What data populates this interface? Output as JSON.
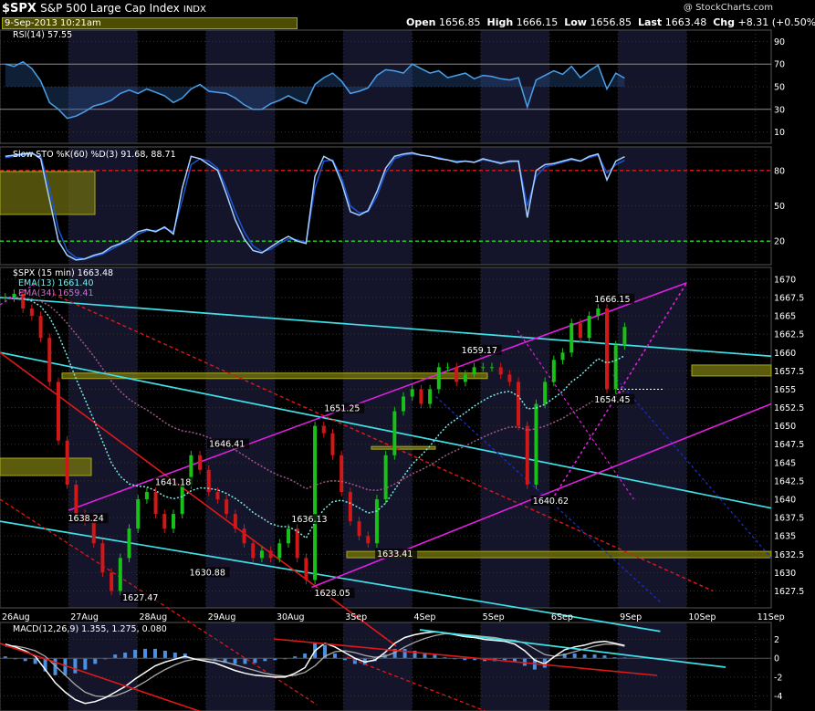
{
  "header": {
    "symbol": "$SPX",
    "name": "S&P 500 Large Cap Index",
    "exchange": "INDX",
    "datetime": "9-Sep-2013 10:21am",
    "copyright": "@ StockCharts.com",
    "open_label": "Open",
    "open": "1656.85",
    "high_label": "High",
    "high": "1666.15",
    "low_label": "Low",
    "low": "1656.85",
    "last_label": "Last",
    "last": "1663.48",
    "chg_label": "Chg",
    "chg": "+8.31 (+0.50%)"
  },
  "colors": {
    "background": "#000000",
    "session_band": "#14142a",
    "cyan": "#40e0e8",
    "magenta": "#e020e0",
    "red": "#e01818",
    "blue": "#1a2cc8",
    "up": "#18c018",
    "down": "#d01818",
    "highlight": "#6b6b10"
  },
  "x_axis": {
    "labels": [
      "26Aug",
      "27Aug",
      "28Aug",
      "29Aug",
      "30Aug",
      "3Sep",
      "4Sep",
      "5Sep",
      "6Sep",
      "9Sep",
      "10Sep",
      "11Sep"
    ],
    "positions": [
      0,
      26,
      52,
      78,
      104,
      130,
      156,
      182,
      208,
      234,
      260,
      286
    ]
  },
  "chart_data": [
    {
      "type": "line",
      "panel": "rsi",
      "title": "RSI(14) 57.55",
      "ylim": [
        0,
        100
      ],
      "yticks": [
        90,
        70,
        50,
        30,
        10
      ],
      "reference_lines": [
        70,
        30
      ],
      "series": [
        {
          "name": "RSI(14)",
          "values": [
            70,
            68,
            72,
            66,
            55,
            36,
            30,
            22,
            24,
            28,
            33,
            35,
            38,
            44,
            47,
            44,
            48,
            45,
            42,
            36,
            40,
            48,
            52,
            46,
            45,
            44,
            40,
            34,
            30,
            30,
            35,
            38,
            42,
            38,
            35,
            52,
            58,
            62,
            55,
            44,
            46,
            49,
            60,
            65,
            64,
            62,
            70,
            66,
            62,
            64,
            58,
            60,
            62,
            57,
            60,
            59,
            57,
            56,
            58,
            32,
            56,
            60,
            64,
            61,
            68,
            58,
            64,
            69,
            48,
            62,
            57.55
          ]
        }
      ]
    },
    {
      "type": "line",
      "panel": "stochastic",
      "title": "Slow STO %K(60) %D(3) 91.68, 88.71",
      "ylim": [
        0,
        100
      ],
      "yticks": [
        80,
        50,
        20
      ],
      "reference_lines": [
        80,
        20
      ],
      "series": [
        {
          "name": "%K",
          "values": [
            92,
            93,
            94,
            95,
            90,
            55,
            20,
            8,
            4,
            5,
            8,
            10,
            15,
            18,
            22,
            28,
            30,
            28,
            32,
            26,
            65,
            92,
            90,
            85,
            80,
            60,
            38,
            22,
            12,
            10,
            15,
            20,
            24,
            20,
            18,
            75,
            92,
            88,
            70,
            45,
            42,
            46,
            62,
            82,
            92,
            94,
            95,
            93,
            92,
            90,
            89,
            87,
            88,
            87,
            90,
            88,
            86,
            88,
            88,
            40,
            80,
            85,
            86,
            88,
            90,
            88,
            92,
            94,
            72,
            88,
            91.68
          ]
        },
        {
          "name": "%D",
          "values": [
            91,
            92,
            93,
            94,
            92,
            65,
            30,
            12,
            6,
            5,
            7,
            9,
            13,
            17,
            20,
            26,
            29,
            29,
            31,
            28,
            55,
            85,
            90,
            88,
            82,
            65,
            45,
            28,
            16,
            11,
            13,
            18,
            22,
            21,
            19,
            65,
            88,
            89,
            74,
            50,
            44,
            45,
            58,
            78,
            90,
            93,
            94,
            93,
            92,
            91,
            89,
            88,
            88,
            87,
            89,
            88,
            87,
            87,
            88,
            50,
            75,
            83,
            85,
            87,
            89,
            88,
            91,
            93,
            78,
            85,
            88.71
          ]
        }
      ]
    },
    {
      "type": "line",
      "panel": "price",
      "title": "$SPX (15 min) 1663.48",
      "legend": [
        "EMA(13) 1661.40",
        "EMA(34) 1659.41"
      ],
      "ylim": [
        1625.2,
        1671.6
      ],
      "yticks": [
        1670,
        1667.5,
        1665,
        1662.5,
        1660,
        1657.5,
        1655,
        1652.5,
        1650,
        1647.5,
        1645,
        1642.5,
        1640,
        1637.5,
        1635,
        1632.5,
        1630,
        1627.5
      ],
      "annotations": [
        {
          "label": "1666.15",
          "x": 232.3,
          "y": 1666.15
        },
        {
          "label": "1659.17",
          "x": 182,
          "y": 1659.17
        },
        {
          "label": "1651.25",
          "x": 130,
          "y": 1651.25
        },
        {
          "label": "1654.45",
          "x": 232.3,
          "y": 1654.45
        },
        {
          "label": "1646.41",
          "x": 86.4,
          "y": 1646.41
        },
        {
          "label": "1641.18",
          "x": 66,
          "y": 1641.18
        },
        {
          "label": "1638.24",
          "x": 33,
          "y": 1638.24
        },
        {
          "label": "1636.13",
          "x": 117.6,
          "y": 1636.13
        },
        {
          "label": "1640.62",
          "x": 209,
          "y": 1640.62
        },
        {
          "label": "1633.41",
          "x": 150,
          "y": 1633.41
        },
        {
          "label": "1630.88",
          "x": 79,
          "y": 1630.88
        },
        {
          "label": "1627.47",
          "x": 53.6,
          "y": 1627.47
        },
        {
          "label": "1628.05",
          "x": 126.3,
          "y": 1628.05
        }
      ],
      "series": [
        {
          "name": "$SPX",
          "values": [
            1667.5,
            1668,
            1666,
            1665,
            1662,
            1656,
            1648,
            1642,
            1638,
            1637,
            1634,
            1630,
            1627.5,
            1632,
            1636,
            1640,
            1641,
            1638,
            1636,
            1638,
            1642,
            1646,
            1644,
            1641,
            1640,
            1638,
            1636,
            1634,
            1632,
            1633,
            1632,
            1634,
            1636,
            1632,
            1629,
            1650,
            1649,
            1646,
            1641,
            1637,
            1635,
            1634,
            1640,
            1646,
            1652,
            1654,
            1655,
            1653,
            1655,
            1658,
            1658,
            1656,
            1657,
            1658,
            1658,
            1658,
            1657,
            1656,
            1650,
            1642,
            1653,
            1656,
            1659,
            1660,
            1664,
            1662,
            1665,
            1666,
            1655,
            1661,
            1663.48
          ]
        }
      ]
    },
    {
      "type": "line",
      "panel": "macd",
      "title": "MACD(12,26,9) 1.355, 1.275, 0.080",
      "ylim": [
        -5.6,
        3.8
      ],
      "yticks": [
        2,
        0,
        -2,
        -4
      ],
      "series": [
        {
          "name": "MACD",
          "values": [
            1.5,
            1.2,
            0.8,
            0.2,
            -1.2,
            -2.6,
            -3.6,
            -4.4,
            -4.8,
            -4.6,
            -4.2,
            -3.6,
            -3.0,
            -2.2,
            -1.5,
            -0.8,
            -0.4,
            -0.1,
            0.2,
            -0.1,
            -0.3,
            -0.5,
            -0.9,
            -1.3,
            -1.6,
            -1.8,
            -1.9,
            -2.0,
            -2.0,
            -1.6,
            -1.0,
            0.8,
            1.6,
            1.2,
            0.6,
            0.0,
            -0.4,
            -0.2,
            0.6,
            1.6,
            2.2,
            2.5,
            2.7,
            2.8,
            2.7,
            2.5,
            2.3,
            2.2,
            2.0,
            1.9,
            1.8,
            1.5,
            0.8,
            -0.2,
            -0.6,
            0.2,
            0.9,
            1.2,
            1.4,
            1.7,
            1.8,
            1.6,
            1.355
          ]
        },
        {
          "name": "Signal",
          "values": [
            1.3,
            1.3,
            1.1,
            0.8,
            0.2,
            -0.8,
            -1.8,
            -2.8,
            -3.6,
            -4.0,
            -4.1,
            -4.0,
            -3.6,
            -3.1,
            -2.5,
            -1.8,
            -1.2,
            -0.7,
            -0.3,
            -0.1,
            -0.1,
            -0.2,
            -0.4,
            -0.7,
            -1.0,
            -1.3,
            -1.6,
            -1.8,
            -1.9,
            -1.8,
            -1.5,
            -0.8,
            0.2,
            0.7,
            0.8,
            0.6,
            0.3,
            0.1,
            0.2,
            0.6,
            1.2,
            1.7,
            2.1,
            2.4,
            2.6,
            2.6,
            2.5,
            2.4,
            2.3,
            2.2,
            2.0,
            1.9,
            1.6,
            1.0,
            0.4,
            0.2,
            0.4,
            0.7,
            1.0,
            1.3,
            1.5,
            1.5,
            1.275
          ]
        }
      ]
    }
  ]
}
